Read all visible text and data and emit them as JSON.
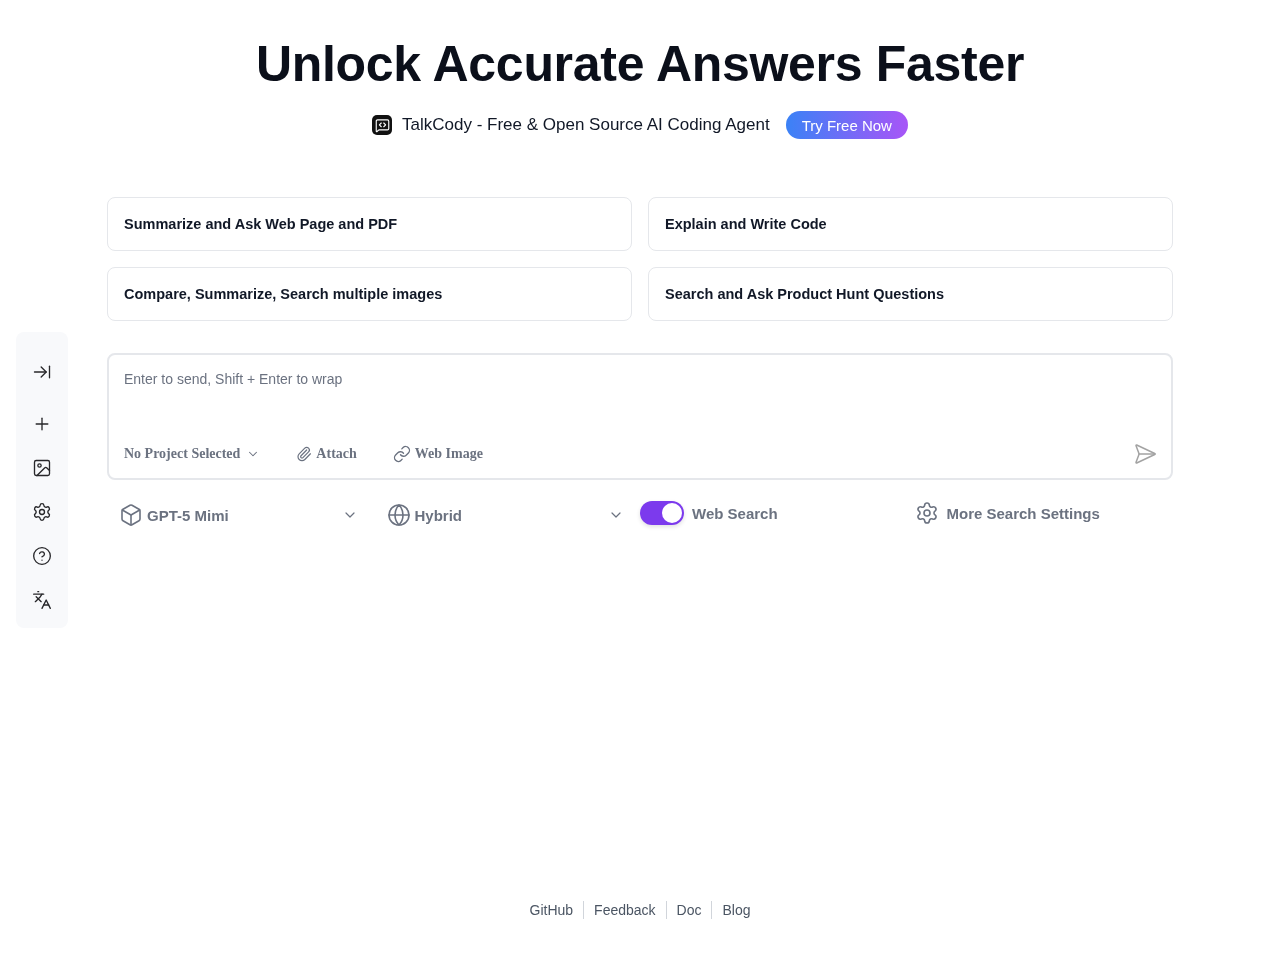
{
  "hero": {
    "title": "Unlock Accurate Answers Faster",
    "promo": {
      "text": "TalkCody - Free & Open Source AI Coding Agent",
      "button": "Try Free Now"
    }
  },
  "suggestions": [
    "Summarize and Ask Web Page and PDF",
    "Explain and Write Code",
    "Compare, Summarize, Search multiple images",
    "Search and Ask Product Hunt Questions"
  ],
  "composer": {
    "placeholder": "Enter to send, Shift + Enter to wrap",
    "project": "No Project Selected",
    "attach": "Attach",
    "web_image": "Web Image"
  },
  "options": {
    "model": "GPT-5 Mimi",
    "mode": "Hybrid",
    "web_search": {
      "label": "Web Search",
      "on": true
    },
    "more_settings": "More Search Settings"
  },
  "footer": {
    "links": [
      "GitHub",
      "Feedback",
      "Doc",
      "Blog"
    ]
  }
}
